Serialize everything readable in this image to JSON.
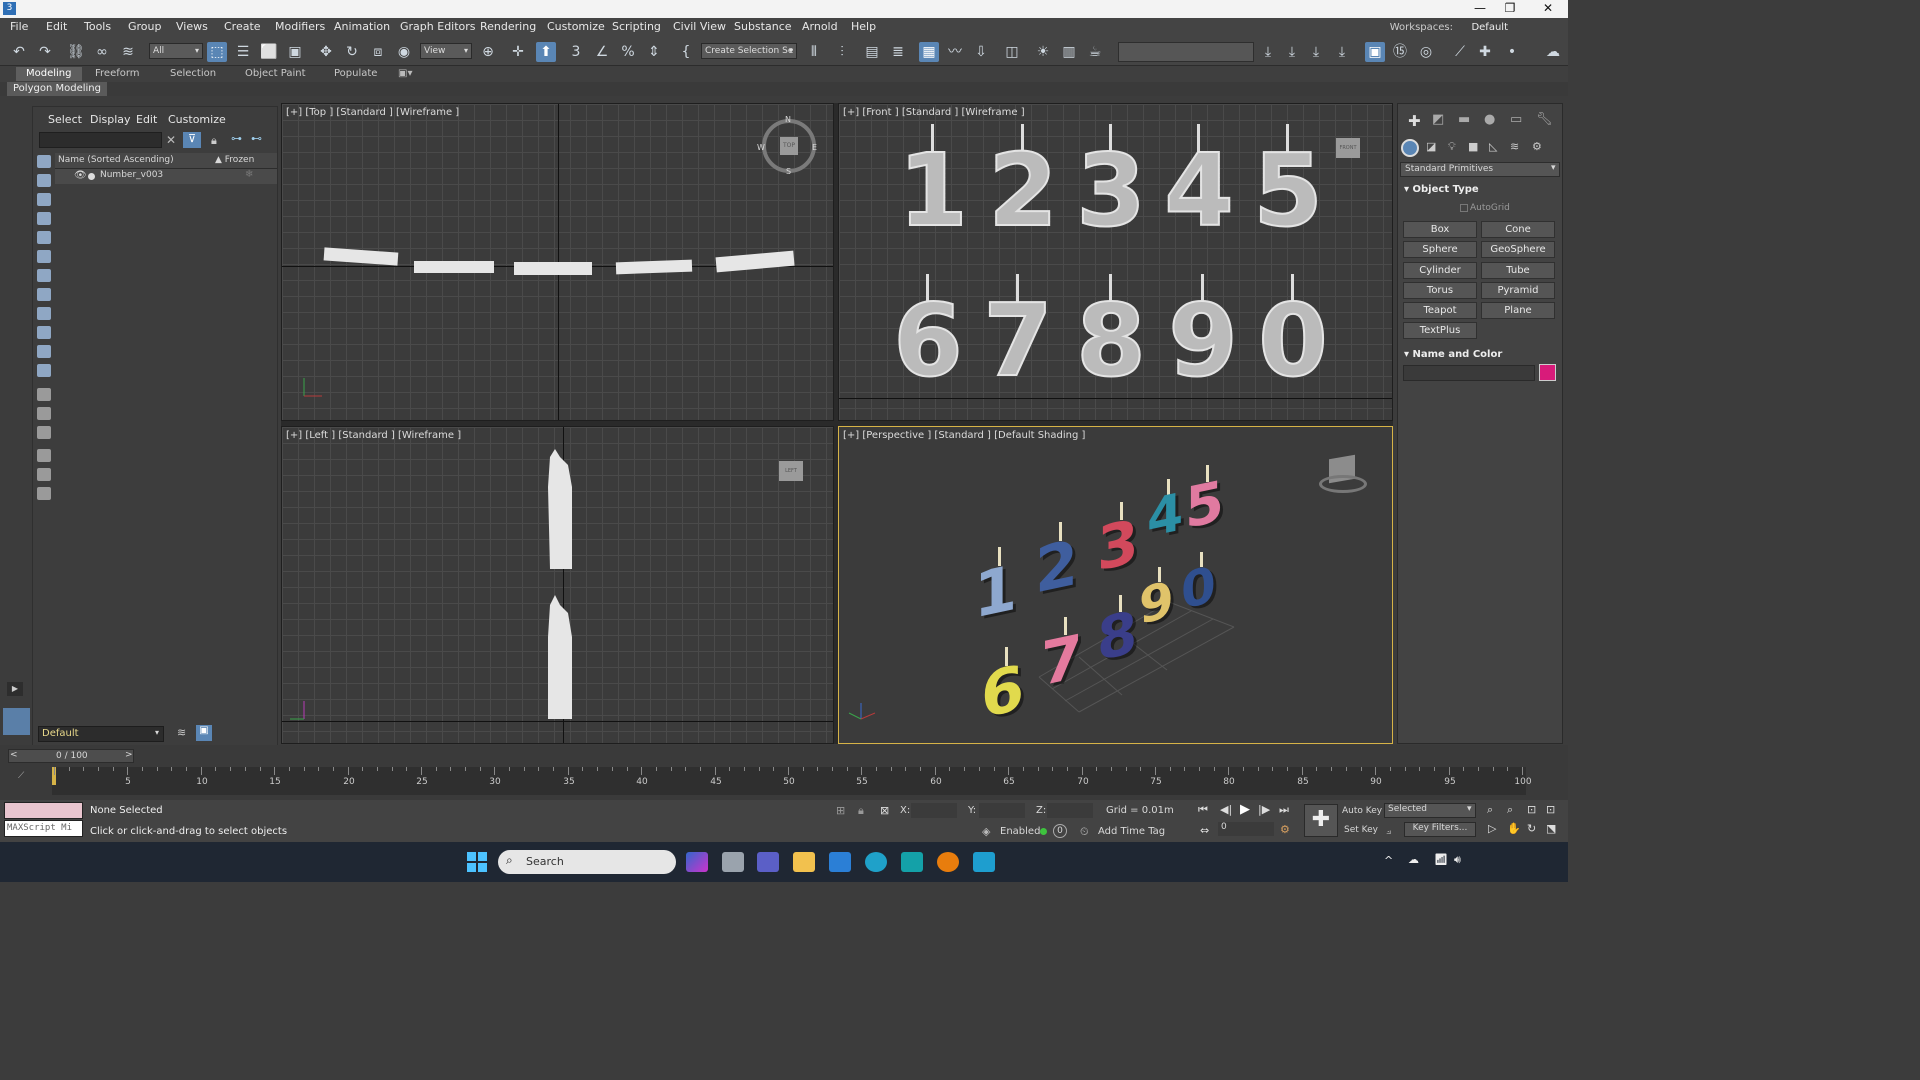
{
  "window": {
    "minimize": "—",
    "maximize": "❐",
    "close": "✕"
  },
  "menus": [
    "File",
    "Edit",
    "Tools",
    "Group",
    "Views",
    "Create",
    "Modifiers",
    "Animation",
    "Graph Editors",
    "Rendering",
    "Customize",
    "Scripting",
    "Civil View",
    "Substance",
    "Arnold",
    "Help"
  ],
  "workspaces": {
    "label": "Workspaces:",
    "value": "Default"
  },
  "toolbar": {
    "filter": "All",
    "ref_coord": "View",
    "selection_set": "Create Selection Se"
  },
  "ribbon_tabs": [
    "Modeling",
    "Freeform",
    "Selection",
    "Object Paint",
    "Populate"
  ],
  "ribbon_sub": "Polygon Modeling",
  "explorer": {
    "menus": [
      "Select",
      "Display",
      "Edit",
      "Customize"
    ],
    "col_name": "Name (Sorted Ascending)",
    "col_frozen": "▲ Frozen",
    "row": "Number_v003",
    "layer": "Default"
  },
  "viewports": {
    "top": "[+] [Top ] [Standard ] [Wireframe ]",
    "front": "[+] [Front ] [Standard ] [Wireframe ]",
    "left": "[+] [Left ] [Standard ] [Wireframe ]",
    "persp": "[+] [Perspective ] [Standard ] [Default Shading ]",
    "compass": {
      "n": "N",
      "s": "S",
      "e": "E",
      "w": "W",
      "top": "TOP"
    },
    "cube_front": "FRONT",
    "cube_left": "LEFT",
    "front_digits": [
      "1",
      "2",
      "3",
      "4",
      "5",
      "6",
      "7",
      "8",
      "9",
      "0"
    ],
    "persp_digits": [
      "1",
      "2",
      "3",
      "4",
      "5",
      "6",
      "7",
      "8",
      "9",
      "0"
    ]
  },
  "command_panel": {
    "category": "Standard Primitives",
    "object_type": "Object Type",
    "autogrid": "AutoGrid",
    "buttons": [
      "Box",
      "Cone",
      "Sphere",
      "GeoSphere",
      "Cylinder",
      "Tube",
      "Torus",
      "Pyramid",
      "Teapot",
      "Plane",
      "TextPlus"
    ],
    "name_color": "Name and Color",
    "swatch": "#d81b7a"
  },
  "timeline": {
    "frame": "0 / 100",
    "ticks": [
      "5",
      "10",
      "15",
      "20",
      "25",
      "30",
      "35",
      "40",
      "45",
      "50",
      "55",
      "60",
      "65",
      "70",
      "75",
      "80",
      "85",
      "90",
      "95",
      "100"
    ]
  },
  "status": {
    "maxscript": "MAXScript Mi",
    "selection": "None Selected",
    "prompt": "Click or click-and-drag to select objects",
    "x": "X:",
    "y": "Y:",
    "z": "Z:",
    "grid": "Grid = 0.01m",
    "enabled": "Enabled:",
    "add_time_tag": "Add Time Tag",
    "auto_key": "Auto Key",
    "set_key": "Set Key",
    "selected": "Selected",
    "key_filters": "Key Filters...",
    "frame_val": "0"
  },
  "taskbar": {
    "search": "Search"
  }
}
